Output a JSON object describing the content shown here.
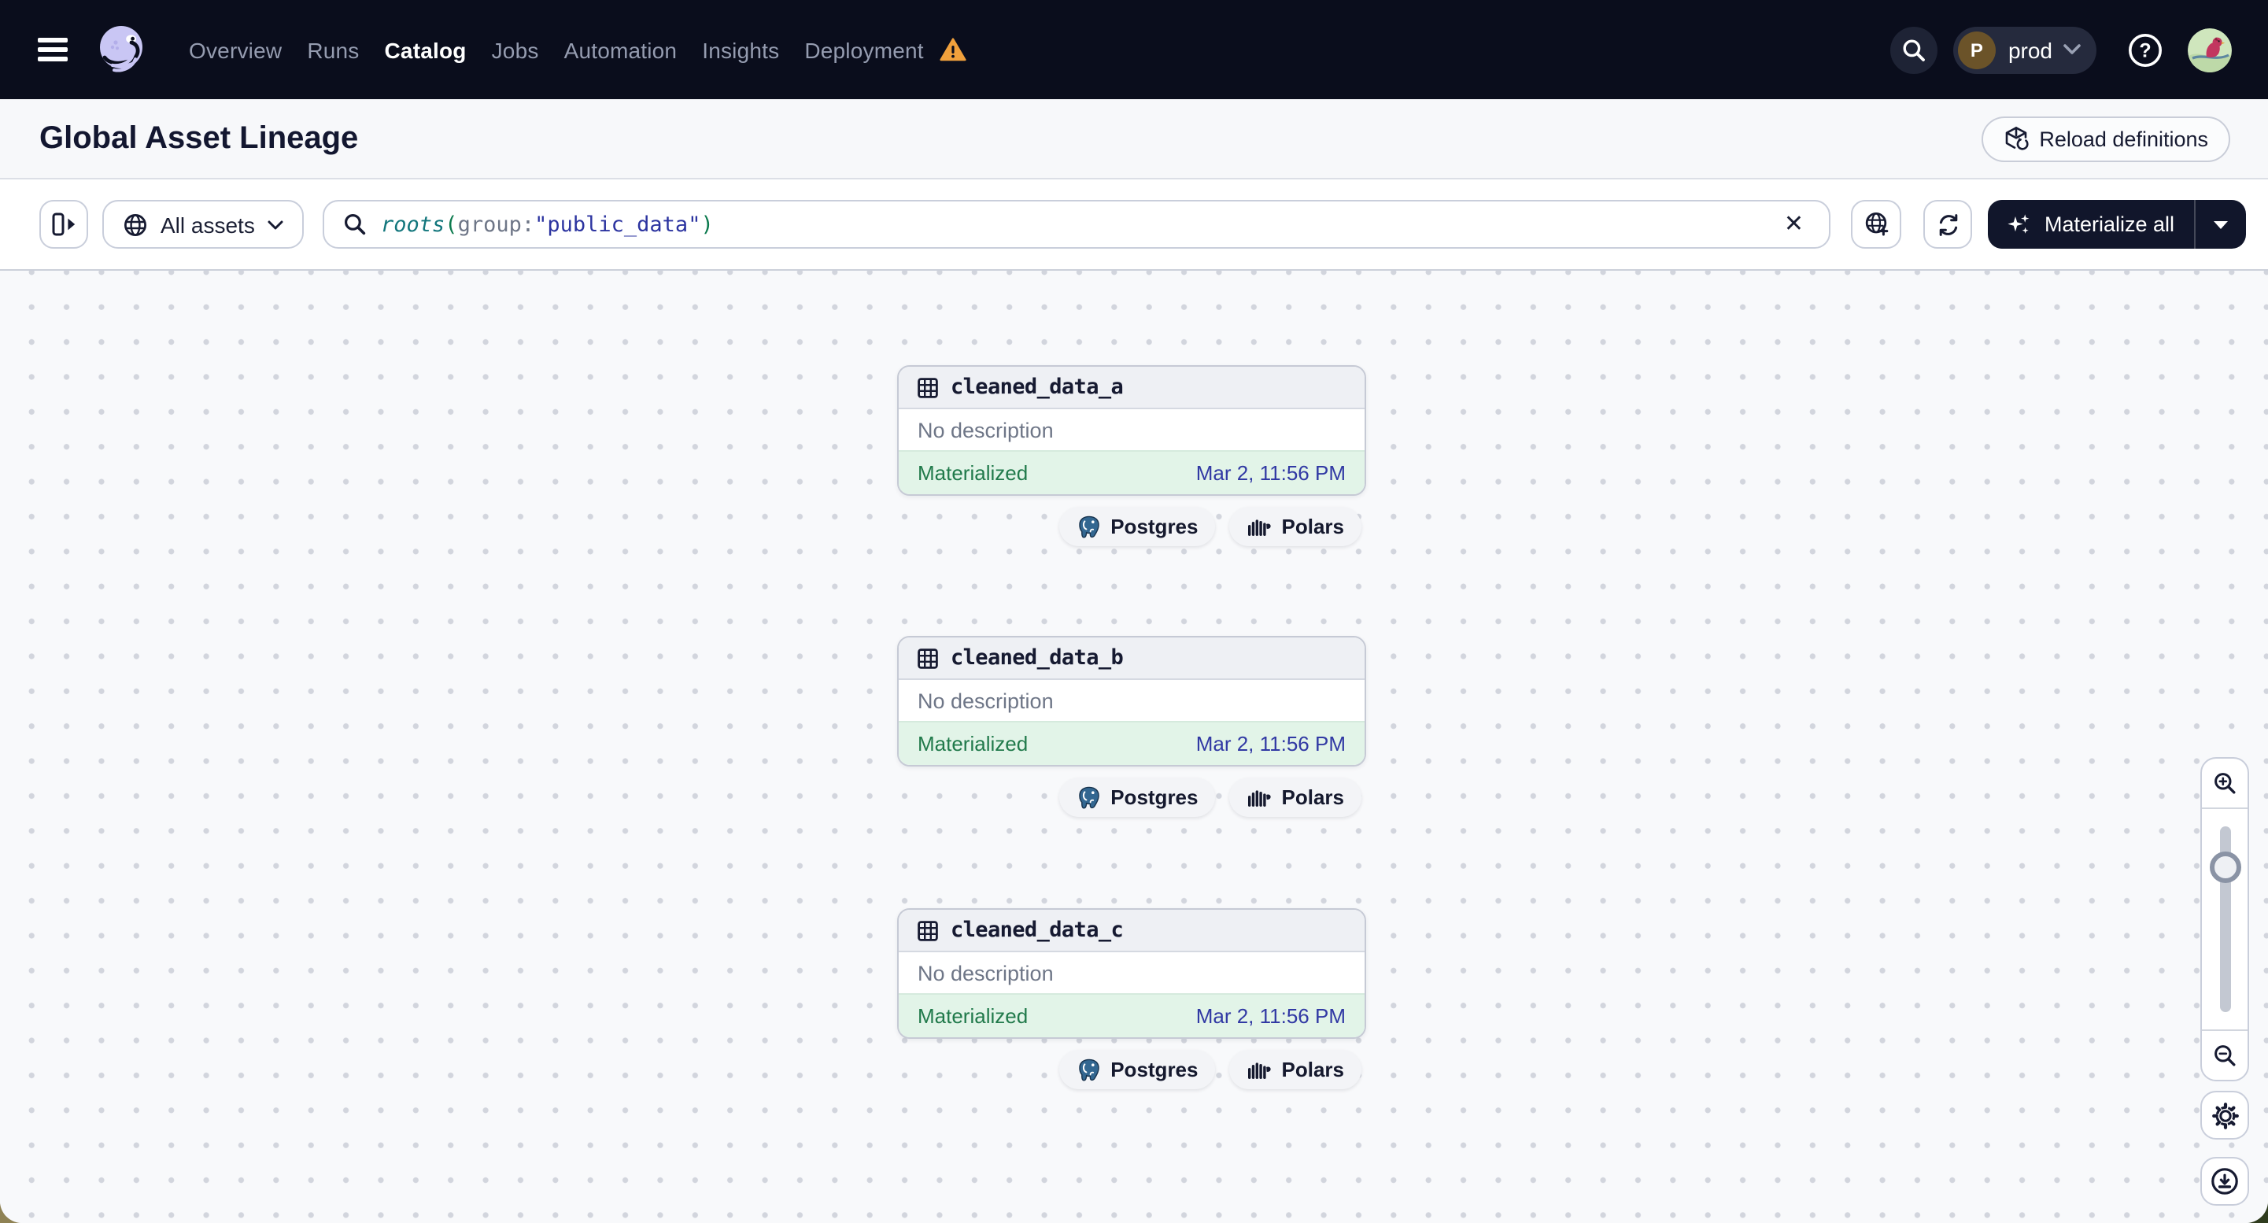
{
  "nav": {
    "items": [
      "Overview",
      "Runs",
      "Catalog",
      "Jobs",
      "Automation",
      "Insights",
      "Deployment"
    ],
    "active_item": "Catalog",
    "deployment_warning": true,
    "env_initial": "P",
    "env_label": "prod"
  },
  "header": {
    "title": "Global Asset Lineage",
    "reload_label": "Reload definitions"
  },
  "toolbar": {
    "scope_label": "All assets",
    "search": {
      "fn": "roots",
      "open_paren": "(",
      "key": "group",
      "colon": ":",
      "value": "\"public_data\"",
      "close_paren": ")"
    },
    "materialize_label": "Materialize all"
  },
  "graph": {
    "nodes": [
      {
        "name": "cleaned_data_a",
        "description": "No description",
        "status": "Materialized",
        "timestamp": "Mar 2, 11:56 PM",
        "tags": [
          "Postgres",
          "Polars"
        ]
      },
      {
        "name": "cleaned_data_b",
        "description": "No description",
        "status": "Materialized",
        "timestamp": "Mar 2, 11:56 PM",
        "tags": [
          "Postgres",
          "Polars"
        ]
      },
      {
        "name": "cleaned_data_c",
        "description": "No description",
        "status": "Materialized",
        "timestamp": "Mar 2, 11:56 PM",
        "tags": [
          "Postgres",
          "Polars"
        ]
      }
    ]
  },
  "icons": [
    "hamburger",
    "dagster-logo",
    "warning-triangle",
    "search",
    "chevron-down",
    "help",
    "user-avatar",
    "box-reload",
    "panel-toggle",
    "globe",
    "magnifier",
    "clear-x",
    "globe-plus",
    "refresh",
    "sparkles",
    "caret-down",
    "table",
    "postgres-elephant",
    "polars-bear",
    "zoom-in",
    "zoom-out",
    "gear",
    "download"
  ],
  "colors": {
    "nav_bg": "#0a0d1c",
    "nav_item": "#959cb0",
    "warning": "#f0a03c",
    "page_bg": "#f8f9fb",
    "status_bg": "#e2f4e8",
    "status_green": "#217a4b",
    "timestamp_indigo": "#3139a4",
    "query_fn_teal": "#12767c",
    "query_paren_green": "#0c7a4e",
    "query_string_indigo": "#2c34a0",
    "dark_button": "#11162b"
  }
}
